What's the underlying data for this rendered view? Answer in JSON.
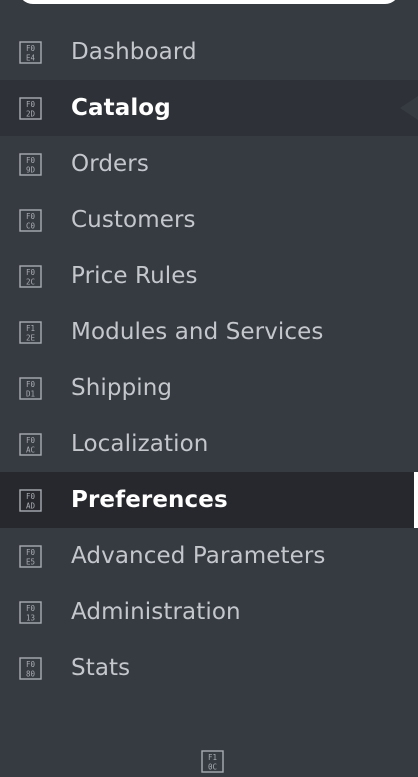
{
  "sidebar": {
    "items": [
      {
        "label": "Dashboard",
        "icon": "dashboard-icon",
        "code": [
          "F0",
          "E4"
        ]
      },
      {
        "label": "Catalog",
        "icon": "catalog-icon",
        "code": [
          "F0",
          "2D"
        ]
      },
      {
        "label": "Orders",
        "icon": "orders-icon",
        "code": [
          "F0",
          "9D"
        ]
      },
      {
        "label": "Customers",
        "icon": "customers-icon",
        "code": [
          "F0",
          "C0"
        ]
      },
      {
        "label": "Price Rules",
        "icon": "price-rules-icon",
        "code": [
          "F0",
          "2C"
        ]
      },
      {
        "label": "Modules and Services",
        "icon": "modules-icon",
        "code": [
          "F1",
          "2E"
        ]
      },
      {
        "label": "Shipping",
        "icon": "shipping-icon",
        "code": [
          "F0",
          "D1"
        ]
      },
      {
        "label": "Localization",
        "icon": "localization-icon",
        "code": [
          "F0",
          "AC"
        ]
      },
      {
        "label": "Preferences",
        "icon": "preferences-icon",
        "code": [
          "F0",
          "AD"
        ]
      },
      {
        "label": "Advanced Parameters",
        "icon": "advanced-parameters-icon",
        "code": [
          "F0",
          "E5"
        ]
      },
      {
        "label": "Administration",
        "icon": "administration-icon",
        "code": [
          "F0",
          "13"
        ]
      },
      {
        "label": "Stats",
        "icon": "stats-icon",
        "code": [
          "F0",
          "80"
        ]
      }
    ],
    "collapse_icon": "collapse-toggle-icon",
    "collapse_code": [
      "F1",
      "0C"
    ]
  },
  "colors": {
    "background": "#363a41",
    "hover_background": "#2e3138",
    "active_background": "#26282d",
    "text": "#c4c7cc",
    "active_text": "#ffffff"
  }
}
